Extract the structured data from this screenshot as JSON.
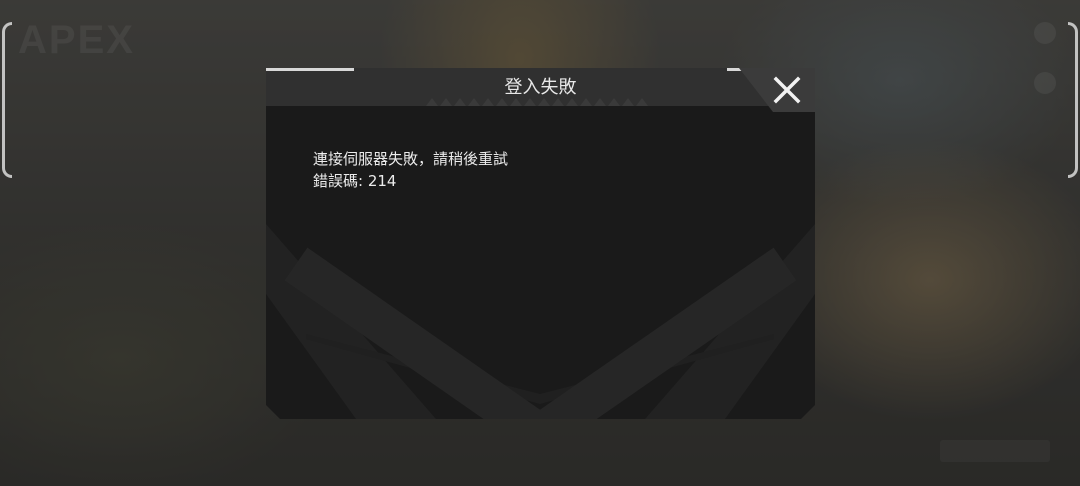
{
  "dialog": {
    "title": "登入失敗",
    "message_line1": "連接伺服器失敗，請稍後重試",
    "message_line2": "錯誤碼: 214",
    "close_icon": "close-x-icon"
  },
  "background": {
    "logo_text": "APEX"
  },
  "colors": {
    "dialog_bg": "#1a1a1a",
    "header_bg": "#303030",
    "text": "#e8e8e8"
  }
}
